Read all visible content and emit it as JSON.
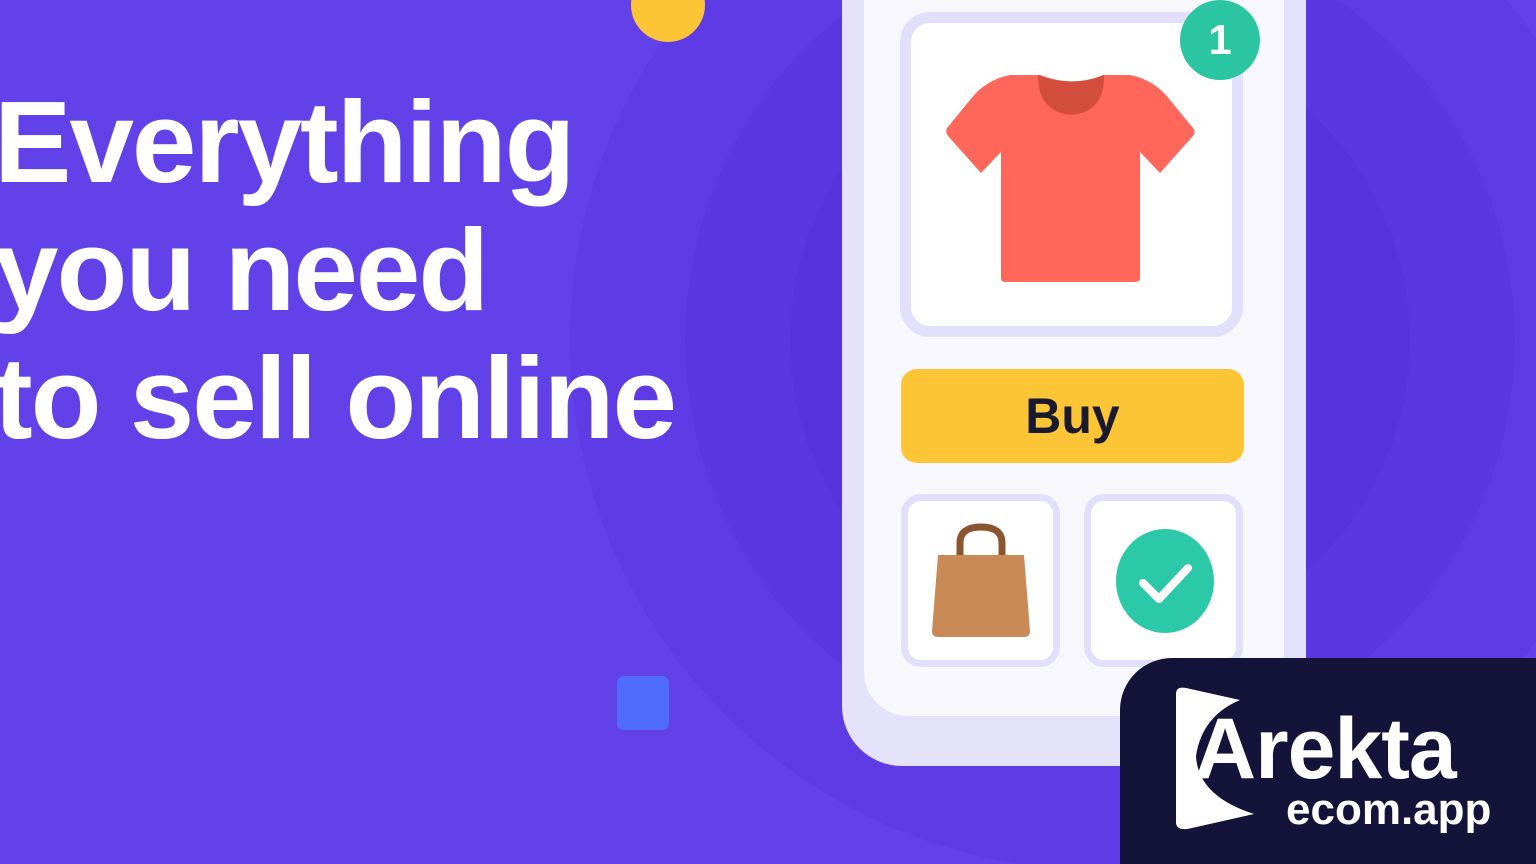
{
  "headline": {
    "lines": [
      "Everything",
      "you need",
      "to sell online"
    ]
  },
  "product_card": {
    "badge_count": "1",
    "product_icon": "t-shirt-icon"
  },
  "buy_button": {
    "label": "Buy"
  },
  "tiles": [
    {
      "icon": "shopping-bag-icon"
    },
    {
      "icon": "check-circle-icon"
    }
  ],
  "logo": {
    "name": "Arekta",
    "domain": "ecom.app"
  },
  "colors": {
    "background": "#6341e9",
    "accent_yellow": "#fcc535",
    "accent_green": "#2bc5a2",
    "shirt": "#ff675a",
    "logo_bg": "#14143a"
  }
}
